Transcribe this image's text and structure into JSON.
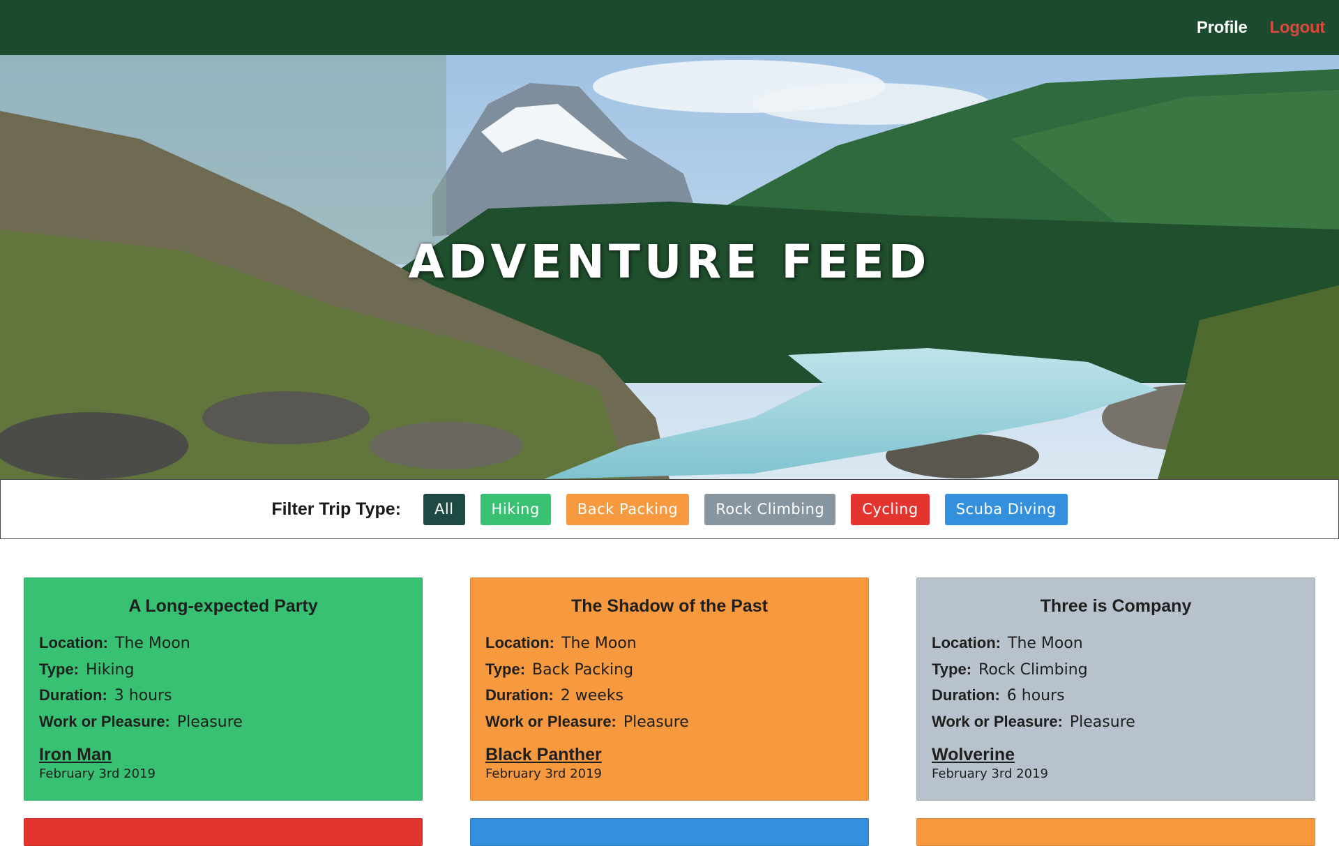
{
  "nav": {
    "profile_label": "Profile",
    "logout_label": "Logout"
  },
  "hero": {
    "title": "ADVENTURE FEED"
  },
  "filter": {
    "label": "Filter Trip Type:",
    "options": [
      {
        "label": "All",
        "color": "#1f4a44"
      },
      {
        "label": "Hiking",
        "color": "#38c172"
      },
      {
        "label": "Back Packing",
        "color": "#f6993f"
      },
      {
        "label": "Rock Climbing",
        "color": "#8795a1"
      },
      {
        "label": "Cycling",
        "color": "#e3342f"
      },
      {
        "label": "Scuba Diving",
        "color": "#3490dc"
      }
    ]
  },
  "fields": {
    "location": "Location:",
    "type": "Type:",
    "duration": "Duration:",
    "work_or_pleasure": "Work or Pleasure:"
  },
  "cards": [
    {
      "title": "A Long-expected Party",
      "location": "The Moon",
      "type": "Hiking",
      "duration": "3 hours",
      "work_or_pleasure": "Pleasure",
      "author": "Iron Man",
      "date": "February 3rd 2019",
      "color": "#38c172"
    },
    {
      "title": "The Shadow of the Past",
      "location": "The Moon",
      "type": "Back Packing",
      "duration": "2 weeks",
      "work_or_pleasure": "Pleasure",
      "author": "Black Panther",
      "date": "February 3rd 2019",
      "color": "#f6993f"
    },
    {
      "title": "Three is Company",
      "location": "The Moon",
      "type": "Rock Climbing",
      "duration": "6 hours",
      "work_or_pleasure": "Pleasure",
      "author": "Wolverine",
      "date": "February 3rd 2019",
      "color": "#b8c2cc"
    },
    {
      "color": "#e3342f"
    },
    {
      "color": "#3490dc"
    },
    {
      "color": "#f6993f"
    }
  ]
}
